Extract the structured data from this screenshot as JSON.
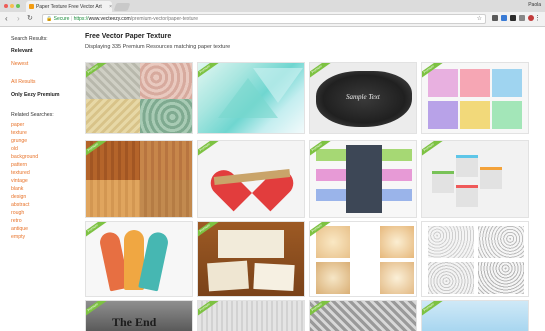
{
  "browser": {
    "tab_title": "Paper Texture Free Vector Art",
    "tab_close": "×",
    "user_name": "Paola",
    "secure_label": "Secure",
    "url_scheme": "https://",
    "url_host": "www.vecteezy.com",
    "url_path": "/premium-vector/paper-texture",
    "back_icon": "‹",
    "forward_icon": "›",
    "reload_icon": "↻",
    "star_icon": "☆",
    "menu_icon": "⋮",
    "colors": {
      "secure": "#1e8e3e",
      "accent": "#e8742b",
      "premium": "#7dc242"
    }
  },
  "sidebar": {
    "search_results_heading": "Search Results:",
    "relevant_label": "Relevant",
    "newest_label": "Newest",
    "all_results_label": "All Results",
    "only_premium_label": "Only Eezy Premium",
    "related_heading": "Related Searches:",
    "related": [
      "paper",
      "texture",
      "grunge",
      "old",
      "background",
      "pattern",
      "textured",
      "vintage",
      "blank",
      "design",
      "abstract",
      "rough",
      "retro",
      "antique",
      "empty"
    ]
  },
  "main": {
    "title": "Free Vector Paper Texture",
    "subtitle": "Displaying 335 Premium Resources matching paper texture",
    "badge_label": "Premium",
    "sample_text": "Sample Text",
    "the_end_text": "The End"
  }
}
